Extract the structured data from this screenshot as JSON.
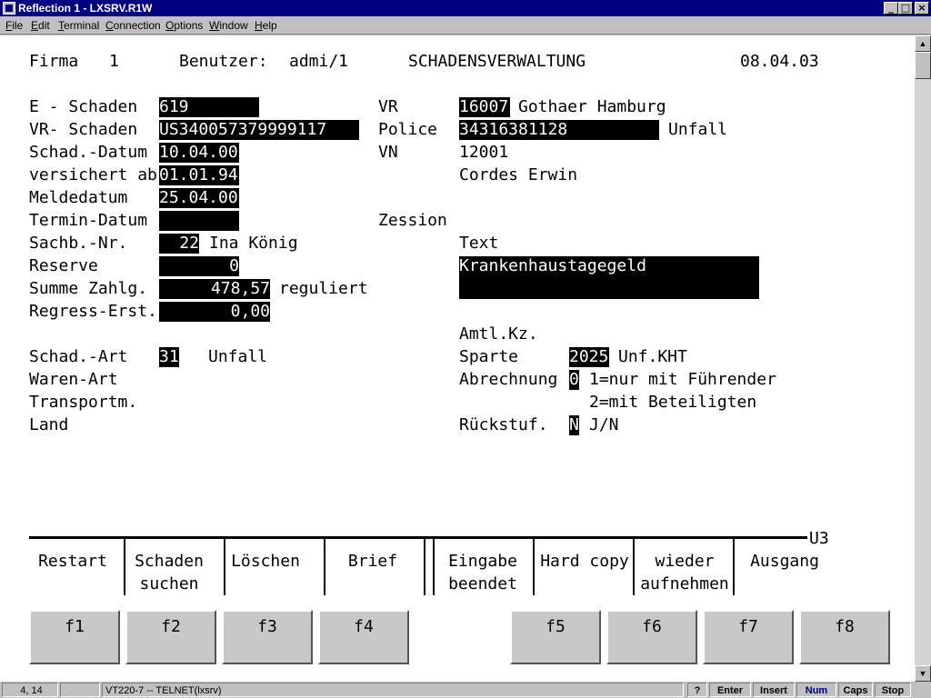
{
  "window": {
    "title": "Reflection 1 - LXSRV.R1W"
  },
  "menu": [
    "File",
    "Edit",
    "Terminal",
    "Connection",
    "Options",
    "Window",
    "Help"
  ],
  "header": {
    "firma_label": "Firma",
    "firma": "1",
    "benutzer_label": "Benutzer:",
    "benutzer": "admi/1",
    "title": "SCHADENSVERWALTUNG",
    "date": "08.04.03"
  },
  "left": {
    "e_schaden_label": "E - Schaden",
    "e_schaden": "619",
    "vr_schaden_label": "VR- Schaden",
    "vr_schaden": "US340057379999117",
    "schad_datum_label": "Schad.-Datum",
    "schad_datum": "10.04.00",
    "versichert_label": "versichert ab",
    "versichert": "01.01.94",
    "meldedatum_label": "Meldedatum",
    "meldedatum": "25.04.00",
    "termin_label": "Termin-Datum",
    "termin": "",
    "sachb_label": "Sachb.-Nr.",
    "sachb_nr": "22",
    "sachb_name": "Ina König",
    "reserve_label": "Reserve",
    "reserve": "0",
    "summe_label": "Summe Zahlg.",
    "summe": "478,57",
    "summe_status": "reguliert",
    "regress_label": "Regress-Erst.",
    "regress": "0,00",
    "art_label": "Schad.-Art",
    "art_code": "31",
    "art_text": "Unfall",
    "waren_label": "Waren-Art",
    "transport_label": "Transportm.",
    "land_label": "Land"
  },
  "right": {
    "vr_label": "VR",
    "vr_code": "16007",
    "vr_name": "Gothaer Hamburg",
    "police_label": "Police",
    "police": "34316381128",
    "police_type": "Unfall",
    "vn_label": "VN",
    "vn": "12001",
    "vn_name": "Cordes Erwin",
    "zession_label": "Zession",
    "text_label": "Text",
    "text_value": "Krankenhaustagegeld",
    "amtl_label": "Amtl.Kz.",
    "sparte_label": "Sparte",
    "sparte_code": "2025",
    "sparte_text": "Unf.KHT",
    "abrechnung_label": "Abrechnung",
    "abrechnung_value": "0",
    "abrechnung_opt1": "1=nur mit Führender",
    "abrechnung_opt2": "2=mit Beteiligten",
    "rueck_label": "Rückstuf.",
    "rueck_value": "N",
    "rueck_hint": "J/N"
  },
  "screen_id": "U3",
  "softkeys": [
    {
      "line1": "Restart",
      "line2": ""
    },
    {
      "line1": "Schaden",
      "line2": "suchen"
    },
    {
      "line1": "Löschen",
      "line2": ""
    },
    {
      "line1": "Brief",
      "line2": ""
    },
    {
      "line1": "Eingabe",
      "line2": "beendet"
    },
    {
      "line1": "Hard copy",
      "line2": ""
    },
    {
      "line1": "wieder",
      "line2": "aufnehmen"
    },
    {
      "line1": "Ausgang",
      "line2": ""
    }
  ],
  "fkeys": [
    "f1",
    "f2",
    "f3",
    "f4",
    "f5",
    "f6",
    "f7",
    "f8"
  ],
  "status": {
    "cursor": "4, 14",
    "session": "VT220-7 -- TELNET(lxsrv)",
    "help": "?",
    "enter": "Enter",
    "insert": "Insert",
    "num": "Num",
    "caps": "Caps",
    "stop": "Stop"
  },
  "colors": {
    "titlebar": "#000080",
    "terminal_bg": "#ffffff",
    "field_bg": "#000000",
    "num_active": "#000080"
  }
}
